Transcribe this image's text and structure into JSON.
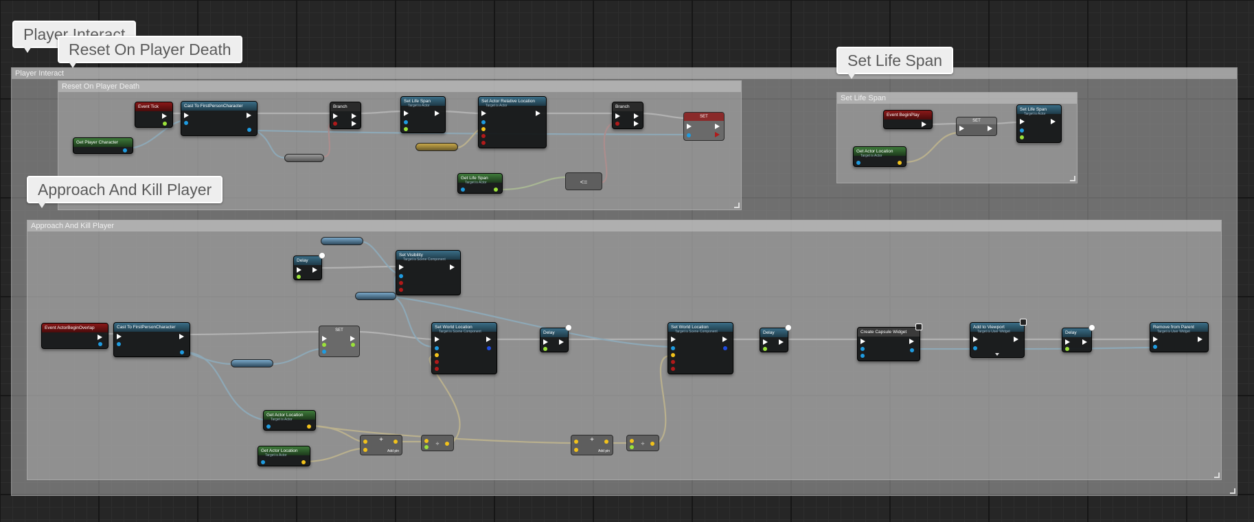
{
  "comments": {
    "player_interact": "Player Interact",
    "reset_on_player_death": "Reset On Player Death",
    "set_life_span": "Set Life Span",
    "approach_and_kill_player": "Approach And Kill Player"
  },
  "nodes": {
    "event_tick": "Event Tick",
    "cast_first_person_1": "Cast To FirstPersonCharacter",
    "get_player_character": "Get Player Character",
    "branch_1": "Branch",
    "set_life_span_fn": "Set Life Span",
    "set_actor_relative_location": "Set Actor Relative Location",
    "branch_2": "Branch",
    "set_node_1": "SET",
    "get_life_span": "Get Life Span",
    "compare_op": "<=",
    "event_beginplay": "Event BeginPlay",
    "set_node_2": "SET",
    "set_life_span_fn_2": "Set Life Span",
    "get_actor_location_1": "Get Actor Location",
    "event_actor_begin_overlap": "Event ActorBeginOverlap",
    "cast_first_person_2": "Cast To FirstPersonCharacter",
    "delay_1": "Delay",
    "set_visibility": "Set Visibility",
    "set_node_3": "SET",
    "set_world_location_1": "Set World Location",
    "delay_2": "Delay",
    "set_world_location_2": "Set World Location",
    "delay_3": "Delay",
    "create_widget": "Create Capsule Widget",
    "add_to_viewport": "Add to Viewport",
    "delay_4": "Delay",
    "remove_from_parent": "Remove from Parent",
    "get_actor_location_2": "Get Actor Location",
    "get_actor_location_3": "Get Actor Location",
    "add_pin_1": "Add pin",
    "add_pin_2": "Add pin"
  },
  "subtitles": {
    "target_actor": "Target is Actor",
    "target_scene": "Target is Scene Component",
    "target_user_widget": "Target is User Widget"
  },
  "colors": {
    "exec": "#ffffff",
    "object": "#1f9be0",
    "vector": "#f2c21b",
    "float": "#9be23a",
    "bool": "#b01a1a",
    "event_header": "#8a1818",
    "function_header": "#3a6d86",
    "pure_header": "#3e7b3a"
  }
}
